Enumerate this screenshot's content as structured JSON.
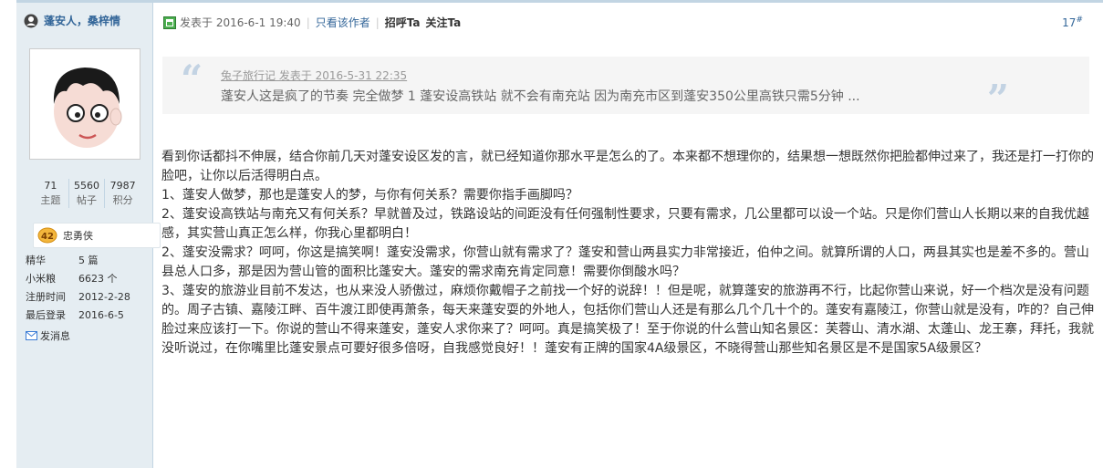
{
  "author": {
    "name": "蓬安人，桑梓情",
    "stats": [
      {
        "value": "71",
        "label": "主题"
      },
      {
        "value": "5560",
        "label": "帖子"
      },
      {
        "value": "7987",
        "label": "积分"
      }
    ],
    "rank": {
      "level": "42",
      "title": "忠勇侠"
    },
    "info": [
      {
        "label": "精华",
        "value": "5 篇"
      },
      {
        "label": "小米粮",
        "value": "6623 个"
      },
      {
        "label": "注册时间",
        "value": "2012-2-28"
      },
      {
        "label": "最后登录",
        "value": "2016-6-5"
      }
    ],
    "message_label": "发消息"
  },
  "post": {
    "posted_at": "发表于 2016-6-1 19:40",
    "only_author": "只看该作者",
    "greet": "招呼Ta",
    "follow": "关注Ta",
    "floor_number": "17",
    "floor_suffix": "#",
    "quote": {
      "source": "兔子旅行记 发表于 2016-5-31 22:35",
      "text": "蓬安人这是疯了的节奏  完全做梦  1 蓬安设高铁站 就不会有南充站 因为南充市区到蓬安350公里高铁只需5分钟 ..."
    },
    "paragraphs": [
      "看到你话都抖不伸展，结合你前几天对蓬安设区发的言，就已经知道你那水平是怎么的了。本来都不想理你的，结果想一想既然你把脸都伸过来了，我还是打一打你的脸吧，让你以后活得明白点。",
      "1、蓬安人做梦，那也是蓬安人的梦，与你有何关系？需要你指手画脚吗？",
      "2、蓬安设高铁站与南充又有何关系？早就普及过，铁路设站的间距没有任何强制性要求，只要有需求，几公里都可以设一个站。只是你们营山人长期以来的自我优越感，其实营山真正怎么样，你我心里都明白！",
      "2、蓬安没需求？呵呵，你这是搞笑啊！蓬安没需求，你营山就有需求了？蓬安和营山两县实力非常接近，伯仲之间。就算所谓的人口，两县其实也是差不多的。营山县总人口多，那是因为营山管的面积比蓬安大。蓬安的需求南充肯定同意！需要你倒酸水吗？",
      "3、蓬安的旅游业目前不发达，也从来没人骄傲过，麻烦你戴帽子之前找一个好的说辞！！但是呢，就算蓬安的旅游再不行，比起你营山来说，好一个档次是没有问题的。周子古镇、嘉陵江畔、百牛渡江即使再萧条，每天来蓬安耍的外地人，包括你们营山人还是有那么几个几十个的。蓬安有嘉陵江，你营山就是没有，咋的？自己伸脸过来应该打一下。你说的营山不得来蓬安，蓬安人求你来了？呵呵。真是搞笑极了！至于你说的什么营山知名景区：芙蓉山、清水湖、太蓬山、龙王寨，拜托，我就没听说过，在你嘴里比蓬安景点可要好很多倍呀，自我感觉良好！！蓬安有正牌的国家4A级景区，不晓得营山那些知名景区是不是国家5A级景区？"
    ]
  }
}
